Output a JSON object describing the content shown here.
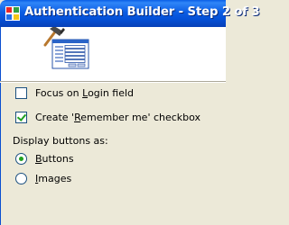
{
  "window": {
    "title": "Authentication Builder - Step 2 of 3",
    "icon": "app-icon"
  },
  "header": {
    "image_icon": "builder-hammer-form-icon"
  },
  "options": {
    "focus_login": {
      "pre": "Focus on ",
      "accel": "L",
      "post": "ogin field",
      "checked": false
    },
    "remember_me": {
      "pre": "Create '",
      "accel": "R",
      "post": "emember me' checkbox",
      "checked": true
    }
  },
  "display_buttons": {
    "label": "Display buttons as:",
    "buttons": {
      "accel": "B",
      "post": "uttons",
      "selected": true
    },
    "images": {
      "accel": "I",
      "post": "mages",
      "selected": false
    }
  },
  "colors": {
    "accent": "#21a121",
    "titlebar": "#0c5de3"
  }
}
